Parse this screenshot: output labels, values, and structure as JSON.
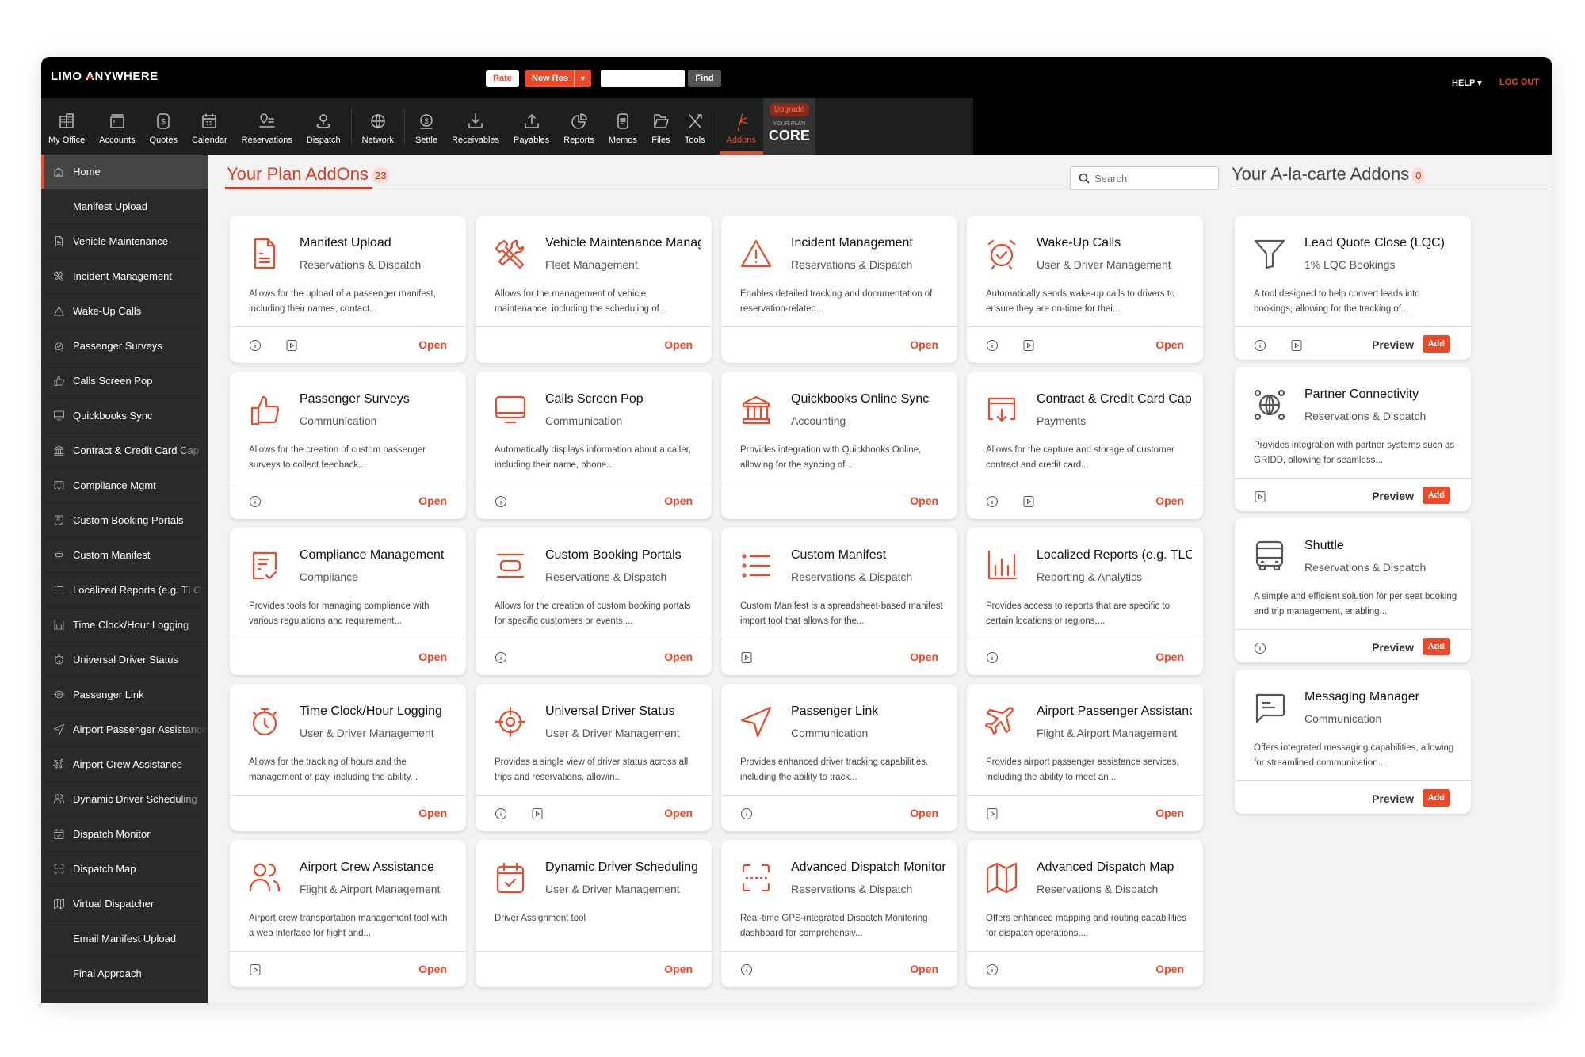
{
  "app": {
    "logo_left": "LIMO ",
    "logo_a": "A",
    "logo_right": "NYWHERE"
  },
  "topbar": {
    "rate": "Rate",
    "new_res": "New Res",
    "find_value": "",
    "find": "Find",
    "help": "HELP ▾",
    "logout": "LOG OUT"
  },
  "nav": [
    {
      "label": "My Office",
      "icon": "building-icon"
    },
    {
      "label": "Accounts",
      "icon": "accounts-icon"
    },
    {
      "label": "Quotes",
      "icon": "dollar-icon"
    },
    {
      "label": "Calendar",
      "icon": "calendar-icon"
    },
    {
      "label": "Reservations",
      "icon": "pin-list-icon"
    },
    {
      "label": "Dispatch",
      "icon": "dispatch-pin-icon"
    },
    {
      "label": "Network",
      "icon": "globe-icon"
    },
    {
      "label": "Settle",
      "icon": "coin-icon"
    },
    {
      "label": "Receivables",
      "icon": "download-tray-icon"
    },
    {
      "label": "Payables",
      "icon": "upload-tray-icon"
    },
    {
      "label": "Reports",
      "icon": "pie-icon"
    },
    {
      "label": "Memos",
      "icon": "memo-icon"
    },
    {
      "label": "Files",
      "icon": "folder-icon"
    },
    {
      "label": "Tools",
      "icon": "tools-icon"
    },
    {
      "label": "Addons",
      "icon": "addons-icon"
    }
  ],
  "plan": {
    "upgrade": "Upgrade",
    "your_plan": "YOUR PLAN",
    "name": "CORE"
  },
  "sidebar": [
    "Home",
    "Manifest Upload",
    "Vehicle Maintenance",
    "Incident Management",
    "Wake-Up Calls",
    "Passenger Surveys",
    "Calls Screen Pop",
    "Quickbooks Sync",
    "Contract & Credit Card Cap",
    "Compliance Mgmt",
    "Custom Booking Portals",
    "Custom Manifest",
    "Localized Reports (e.g. TLC",
    "Time Clock/Hour Logging",
    "Universal Driver Status",
    "Passenger Link",
    "Airport Passenger Assistance",
    "Airport Crew Assistance",
    "Dynamic Driver Scheduling",
    "Dispatch Monitor",
    "Dispatch Map",
    "Virtual Dispatcher",
    "Email Manifest Upload",
    "Final Approach"
  ],
  "main": {
    "title": "Your Plan AddOns",
    "count": "23",
    "search_placeholder": "Search"
  },
  "ala": {
    "title": "Your A-la-carte Addons",
    "count": "0"
  },
  "labels": {
    "open": "Open",
    "preview": "Preview",
    "add": "Add"
  },
  "plan_addons": [
    {
      "title": "Manifest Upload",
      "cat": "Reservations & Dispatch",
      "desc": "Allows for the upload of a passenger manifest, including their names, contact...",
      "info": true,
      "video": true
    },
    {
      "title": "Vehicle Maintenance Management",
      "cat": "Fleet Management",
      "desc": "Allows for the management of vehicle maintenance, including the scheduling of...",
      "info": false,
      "video": false
    },
    {
      "title": "Incident Management",
      "cat": "Reservations & Dispatch",
      "desc": "Enables detailed tracking and documentation of reservation-related...",
      "info": false,
      "video": false
    },
    {
      "title": "Wake-Up Calls",
      "cat": "User & Driver Management",
      "desc": "Automatically sends wake-up calls to drivers to ensure they are on-time for thei...",
      "info": true,
      "video": true
    },
    {
      "title": "Passenger Surveys",
      "cat": "Communication",
      "desc": "Allows for the creation of custom passenger surveys to collect feedback...",
      "info": true,
      "video": false
    },
    {
      "title": "Calls Screen Pop",
      "cat": "Communication",
      "desc": "Automatically displays information about a caller, including their name, phone...",
      "info": true,
      "video": false
    },
    {
      "title": "Quickbooks Online Sync",
      "cat": "Accounting",
      "desc": "Provides integration with Quickbooks Online, allowing for the syncing of...",
      "info": false,
      "video": false
    },
    {
      "title": "Contract & Credit Card Capture",
      "cat": "Payments",
      "desc": "Allows for the capture and storage of customer contract and credit card...",
      "info": true,
      "video": true
    },
    {
      "title": "Compliance Management",
      "cat": "Compliance",
      "desc": "Provides tools for managing compliance with various regulations and requirement...",
      "info": false,
      "video": false
    },
    {
      "title": "Custom Booking Portals",
      "cat": "Reservations & Dispatch",
      "desc": "Allows for the creation of custom booking portals for specific customers or events,...",
      "info": true,
      "video": false
    },
    {
      "title": "Custom Manifest",
      "cat": "Reservations & Dispatch",
      "desc": "Custom Manifest is a spreadsheet-based manifest import tool that allows for the...",
      "info": false,
      "video": true
    },
    {
      "title": "Localized Reports (e.g. TLC)",
      "cat": "Reporting & Analytics",
      "desc": "Provides access to reports that are specific to certain locations or regions,...",
      "info": true,
      "video": false
    },
    {
      "title": "Time Clock/Hour Logging",
      "cat": "User & Driver Management",
      "desc": "Allows for the tracking of hours and the management of pay, including the ability...",
      "info": false,
      "video": false
    },
    {
      "title": "Universal Driver Status",
      "cat": "User & Driver Management",
      "desc": "Provides a single view of driver status across all trips and reservations, allowin...",
      "info": true,
      "video": true
    },
    {
      "title": "Passenger Link",
      "cat": "Communication",
      "desc": "Provides enhanced driver tracking capabilities, including the ability to track...",
      "info": true,
      "video": false
    },
    {
      "title": "Airport Passenger Assistance",
      "cat": "Flight & Airport Management",
      "desc": "Provides airport passenger assistance services, including the ability to meet an...",
      "info": false,
      "video": true
    },
    {
      "title": "Airport Crew Assistance",
      "cat": "Flight & Airport Management",
      "desc": "Airport crew transportation management tool with a web interface for flight and...",
      "info": false,
      "video": true
    },
    {
      "title": "Dynamic Driver Scheduling",
      "cat": "User & Driver Management",
      "desc": "Driver Assignment tool",
      "info": false,
      "video": false
    },
    {
      "title": "Advanced Dispatch Monitor",
      "cat": "Reservations & Dispatch",
      "desc": "Real-time GPS-integrated Dispatch Monitoring dashboard for comprehensiv...",
      "info": true,
      "video": false
    },
    {
      "title": "Advanced Dispatch Map",
      "cat": "Reservations & Dispatch",
      "desc": "Offers enhanced mapping and routing capabilities for dispatch operations,...",
      "info": true,
      "video": false
    }
  ],
  "ala_addons": [
    {
      "title": "Lead Quote Close (LQC)",
      "cat": "1% LQC Bookings",
      "desc": "A tool designed to help convert leads into bookings, allowing for the tracking of...",
      "info": true,
      "video": true
    },
    {
      "title": "Partner Connectivity",
      "cat": "Reservations & Dispatch",
      "desc": "Provides integration with partner systems such as GRIDD, allowing for seamless...",
      "info": false,
      "video": true
    },
    {
      "title": "Shuttle",
      "cat": "Reservations & Dispatch",
      "desc": "A simple and efficient solution for per seat booking and trip management, enabling...",
      "info": true,
      "video": false
    },
    {
      "title": "Messaging Manager",
      "cat": "Communication",
      "desc": "Offers integrated messaging capabilities, allowing for streamlined communication...",
      "info": false,
      "video": false
    }
  ],
  "colors": {
    "accent": "#e84a2a",
    "dark": "#2a2a2a",
    "icon_gray": "#555555"
  }
}
